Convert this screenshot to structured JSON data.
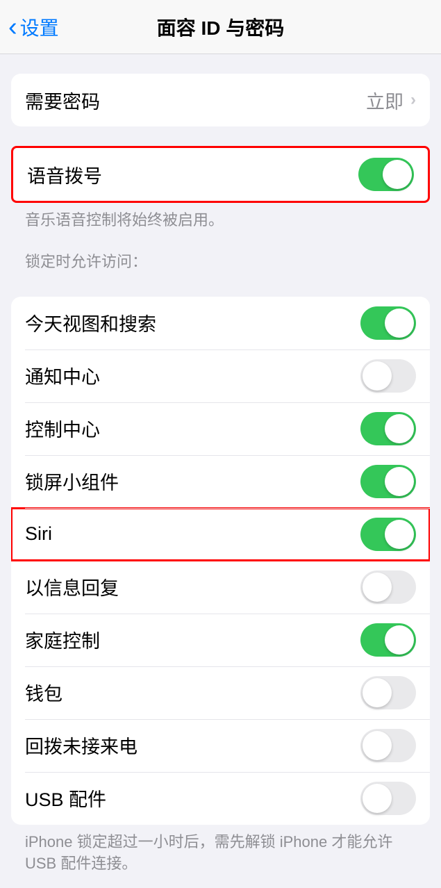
{
  "nav": {
    "back_label": "设置",
    "title": "面容 ID 与密码"
  },
  "require_passcode": {
    "label": "需要密码",
    "value": "立即"
  },
  "voice_dial": {
    "label": "语音拨号",
    "enabled": true,
    "note": "音乐语音控制将始终被启用。"
  },
  "lock_access": {
    "header": "锁定时允许访问：",
    "items": [
      {
        "label": "今天视图和搜索",
        "enabled": true
      },
      {
        "label": "通知中心",
        "enabled": false
      },
      {
        "label": "控制中心",
        "enabled": true
      },
      {
        "label": "锁屏小组件",
        "enabled": true
      },
      {
        "label": "Siri",
        "enabled": true,
        "highlighted": true
      },
      {
        "label": "以信息回复",
        "enabled": false
      },
      {
        "label": "家庭控制",
        "enabled": true
      },
      {
        "label": "钱包",
        "enabled": false
      },
      {
        "label": "回拨未接来电",
        "enabled": false
      },
      {
        "label": "USB 配件",
        "enabled": false
      }
    ],
    "footer": "iPhone 锁定超过一小时后，需先解锁 iPhone 才能允许 USB 配件连接。"
  }
}
